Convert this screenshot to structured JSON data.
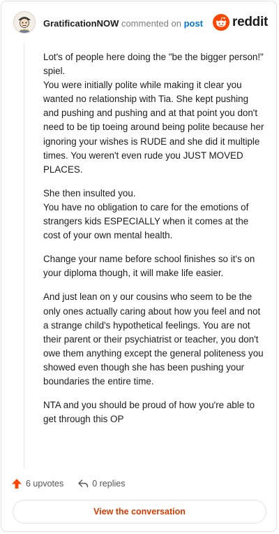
{
  "header": {
    "username": "GratificationNOW",
    "action_text": " commented on ",
    "post_link": "post",
    "brand": "reddit"
  },
  "comment": {
    "paragraphs": [
      "Lot's of people here doing the \"be the bigger person!\" spiel.\nYou were initially polite while making it clear you wanted no relationship with Tia. She kept pushing and pushing and pushing and at that point you don't need to be tip toeing around being polite because her ignoring your wishes is RUDE and she did it multiple times. You weren't even rude you JUST MOVED PLACES.",
      "She then insulted you.\nYou have no obligation to care for the emotions of strangers kids ESPECIALLY when it comes at the cost of your own mental health.",
      "Change your name before school finishes so it's on your diploma though, it will make life easier.",
      "And just lean on y our cousins who seem to be the only ones actually caring about how you feel and not a strange child's hypothetical feelings. You are not their parent or their psychiatrist or teacher, you don't owe them anything except the general politeness you showed even though she has been pushing your boundaries the entire time.",
      "NTA and you should be proud of how you're able to get through this OP"
    ]
  },
  "actions": {
    "upvotes": "6 upvotes",
    "replies": "0 replies"
  },
  "footer": {
    "view_label": "View the conversation"
  },
  "colors": {
    "brand": "#ff4500",
    "link": "#0079d3",
    "button_text": "#d93a00"
  },
  "icons": [
    "user-avatar",
    "reddit-logo-icon",
    "upvote-arrow-icon",
    "reply-arrow-icon"
  ]
}
